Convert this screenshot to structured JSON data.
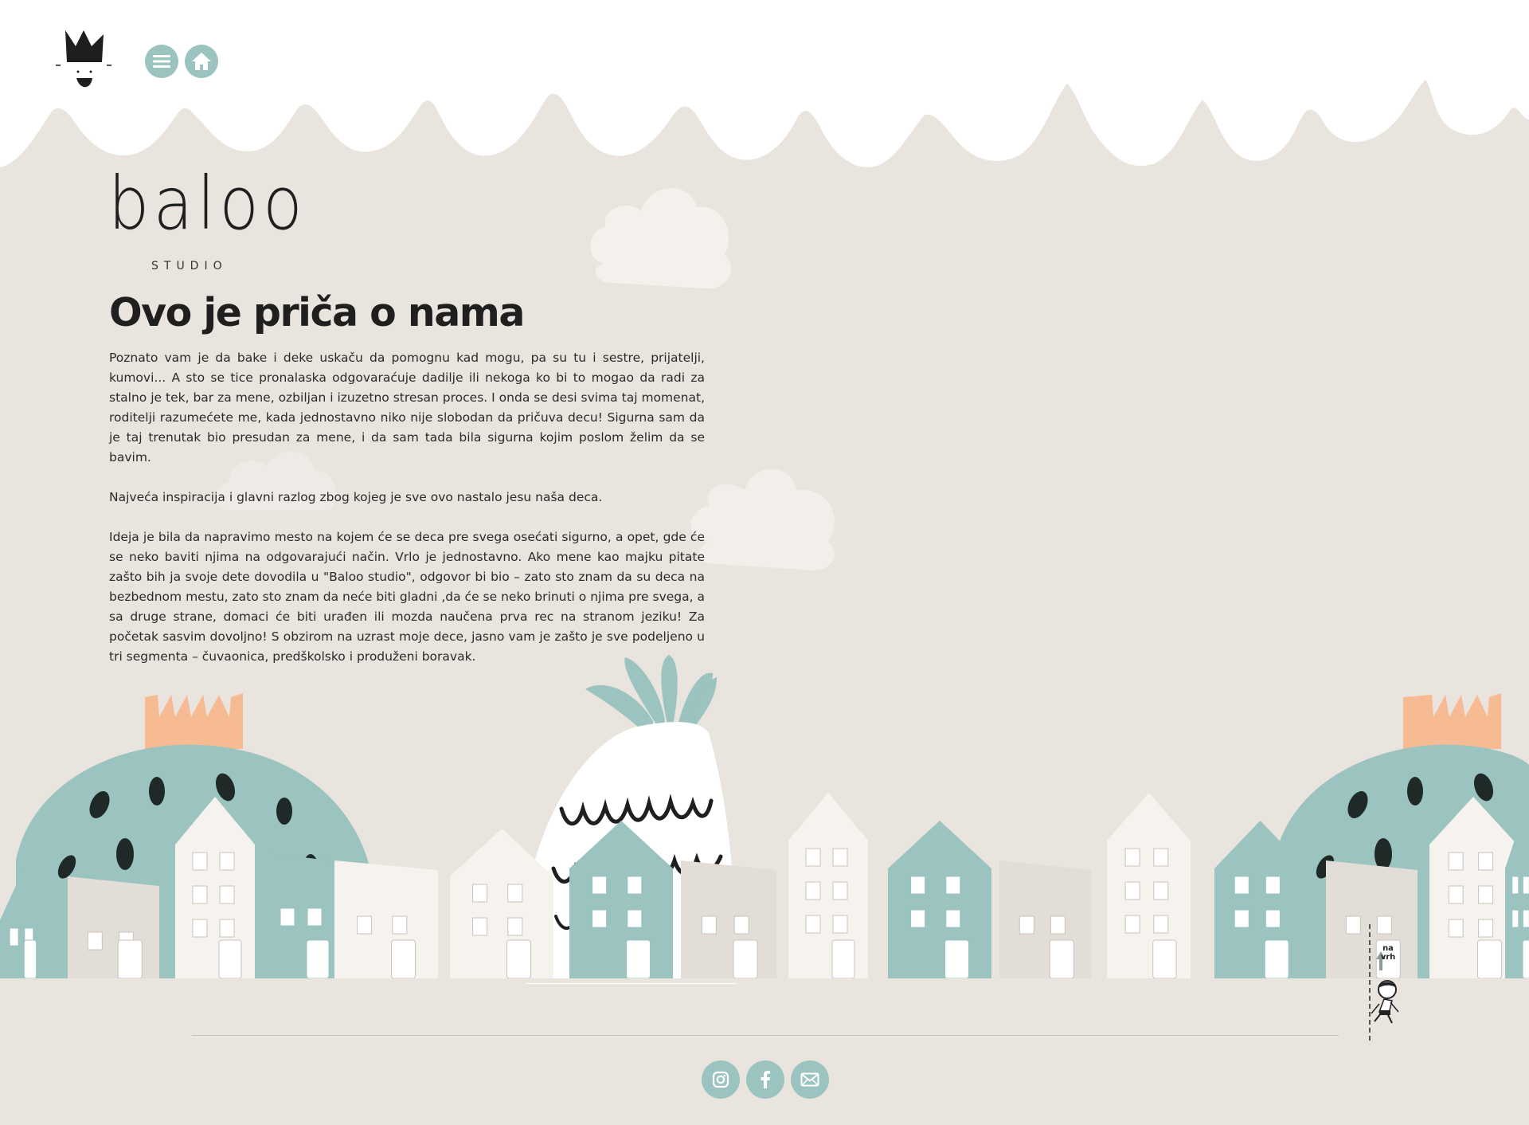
{
  "header": {
    "menu_icon": "hamburger-icon",
    "home_icon": "home-icon",
    "crown_icon": "crown-character-icon"
  },
  "logo": {
    "word": "baloo",
    "sub": "STUDIO"
  },
  "content": {
    "title": "Ovo je priča o nama",
    "paragraphs": [
      "Poznato vam je da bake i deke uskaču da pomognu kad mogu, pa su tu i sestre, prijatelji, kumovi... A sto se tice pronalaska odgovaraćuje dadilje ili nekoga ko bi to mogao da radi za stalno je tek, bar za mene, ozbiljan i izuzetno stresan proces. I onda se desi svima taj momenat, roditelji razumećete me, kada jednostavno niko nije slobodan da pričuva decu! Sigurna sam da je taj trenutak bio presudan za mene, i da sam tada bila sigurna kojim poslom želim da se bavim.",
      "Najveća inspiracija i glavni razlog zbog kojeg je sve ovo nastalo jesu naša deca.",
      "Ideja je bila da napravimo mesto na kojem će se deca pre svega osećati sigurno, a opet, gde će se neko baviti njima na odgovarajući način. Vrlo je jednostavno. Ako mene kao majku pitate zašto bih ja svoje dete dovodila u \"Baloo studio\", odgovor bi bio – zato sto znam da su deca na bezbednom mestu, zato sto znam da neće biti gladni ,da će se neko brinuti o njima pre svega, a sa druge strane, domaci će biti urađen ili mozda naučena prva rec na stranom jeziku! Za početak sasvim dovoljno! S obzirom na uzrast moje dece, jasno vam je zašto je sve podeljeno u tri segmenta – čuvaonica, predškolsko i produženi boravak."
    ]
  },
  "back_to_top": {
    "label_line1": "na",
    "label_line2": "vrh"
  },
  "footer": {
    "social": [
      "instagram-icon",
      "facebook-icon",
      "mail-icon"
    ]
  },
  "colors": {
    "background": "#e9e4de",
    "accent": "#9bc3bf",
    "house_light": "#f6f3ef",
    "house_beige": "#e2ddd6",
    "crown_peach": "#f7bb93",
    "dark": "#1f2a28"
  }
}
